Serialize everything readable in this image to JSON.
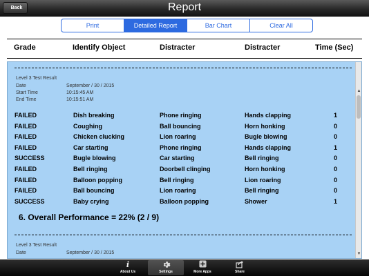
{
  "nav": {
    "title": "Report",
    "back_label": "Back"
  },
  "segments": [
    {
      "label": "Print"
    },
    {
      "label": "Detailed Report"
    },
    {
      "label": "Bar Chart"
    },
    {
      "label": "Clear All"
    }
  ],
  "active_segment": "Detailed Report",
  "columns": [
    "Grade",
    "Identify Object",
    "Distracter",
    "Distracter",
    "Time (Sec)"
  ],
  "result": {
    "title": "Level 3 Test Result",
    "date_label": "Date",
    "date_value": "September / 30 / 2015",
    "start_label": "Start Time",
    "start_value": "10:15:45 AM",
    "end_label": "End Time",
    "end_value": "10:15:51 AM"
  },
  "rows": [
    [
      "FAILED",
      "Dish breaking",
      "Phone ringing",
      "Hands clapping",
      "1"
    ],
    [
      "FAILED",
      "Coughing",
      "Ball bouncing",
      "Horn honking",
      "0"
    ],
    [
      "FAILED",
      "Chicken clucking",
      "Lion roaring",
      "Bugle blowing",
      "0"
    ],
    [
      "FAILED",
      "Car starting",
      "Phone ringing",
      "Hands clapping",
      "1"
    ],
    [
      "SUCCESS",
      "Bugle blowing",
      "Car starting",
      "Bell ringing",
      "0"
    ],
    [
      "FAILED",
      "Bell ringing",
      "Doorbell clinging",
      "Horn honking",
      "0"
    ],
    [
      "FAILED",
      "Balloon popping",
      "Bell ringing",
      "Lion roaring",
      "0"
    ],
    [
      "FAILED",
      "Ball bouncing",
      "Lion roaring",
      "Bell ringing",
      "0"
    ],
    [
      "SUCCESS",
      "Baby crying",
      "Balloon popping",
      "Shower",
      "1"
    ]
  ],
  "overall": "6.  Overall Performance = 22%   (2 / 9)",
  "next_result": {
    "title": "Level 3 Test Result",
    "date_label": "Date",
    "date_value": "September / 30 / 2015"
  },
  "tabs": [
    {
      "label": "About Us",
      "icon": "info-icon"
    },
    {
      "label": "Settings",
      "icon": "gear-icon"
    },
    {
      "label": "More Apps",
      "icon": "plus-icon"
    },
    {
      "label": "Share",
      "icon": "share-icon"
    }
  ],
  "colors": {
    "accent": "#2d6ae0",
    "panel_bg": "#a8d2f5",
    "navbar": "#2a2a2a"
  }
}
